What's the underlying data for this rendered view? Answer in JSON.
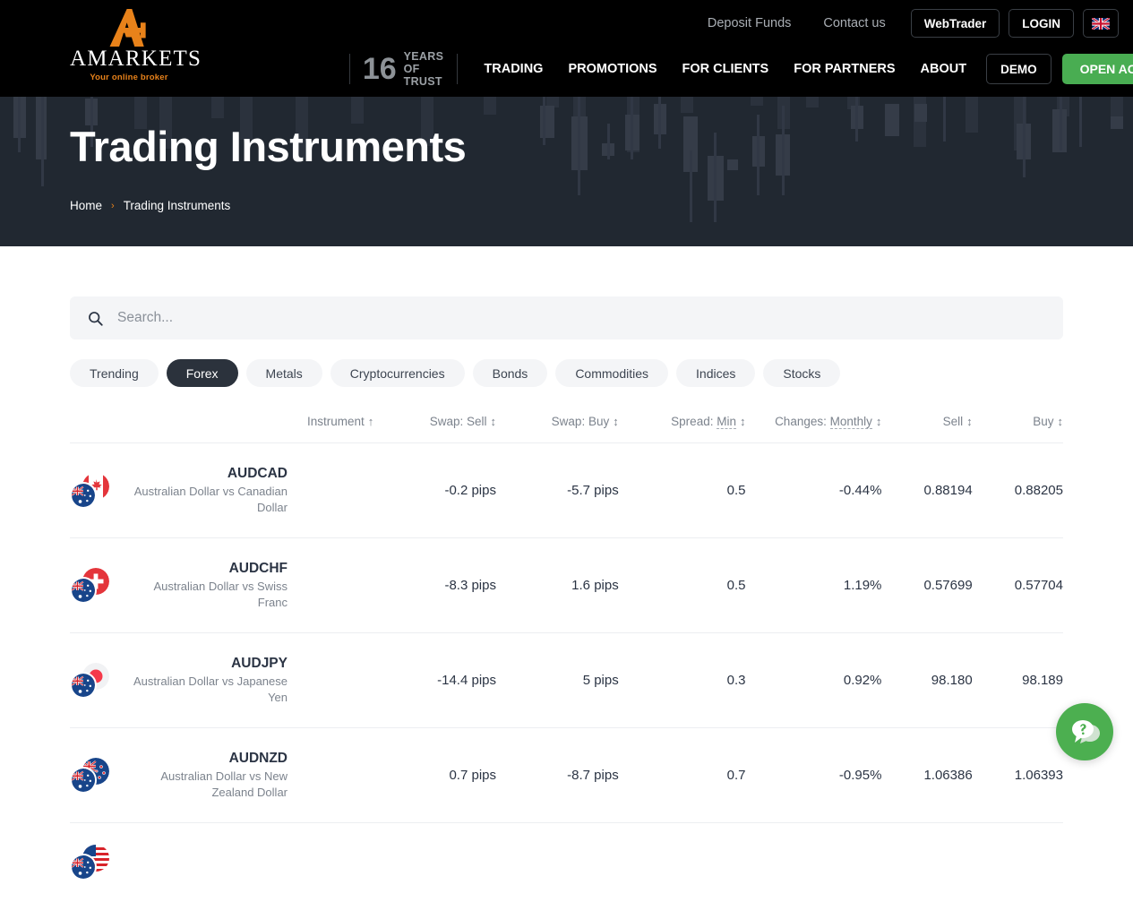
{
  "header": {
    "logo": {
      "word": "AMARKETS",
      "tagline": "Your online broker"
    },
    "top_links": [
      {
        "label": "Deposit Funds"
      },
      {
        "label": "Contact us"
      }
    ],
    "top_buttons": [
      {
        "label": "WebTrader"
      },
      {
        "label": "LOGIN"
      }
    ],
    "language_flag": "uk-flag-icon",
    "trust_badge": {
      "number": "16",
      "line1": "YEARS",
      "line2": "OF TRUST"
    },
    "nav_links": [
      {
        "label": "TRADING"
      },
      {
        "label": "PROMOTIONS"
      },
      {
        "label": "FOR CLIENTS"
      },
      {
        "label": "FOR PARTNERS"
      },
      {
        "label": "ABOUT"
      }
    ],
    "demo_label": "DEMO",
    "open_account_label": "OPEN ACCOUNT",
    "accent_green": "#49ad52",
    "accent_orange": "#e8821a"
  },
  "hero": {
    "title": "Trading Instruments",
    "breadcrumb": {
      "home": "Home",
      "separator": "›",
      "current": "Trading Instruments"
    },
    "background": "#212831"
  },
  "search": {
    "placeholder": "Search...",
    "value": "",
    "icon": "search-icon"
  },
  "filters": {
    "items": [
      {
        "label": "Trending",
        "active": false
      },
      {
        "label": "Forex",
        "active": true
      },
      {
        "label": "Metals",
        "active": false
      },
      {
        "label": "Cryptocurrencies",
        "active": false
      },
      {
        "label": "Bonds",
        "active": false
      },
      {
        "label": "Commodities",
        "active": false
      },
      {
        "label": "Indices",
        "active": false
      },
      {
        "label": "Stocks",
        "active": false
      }
    ]
  },
  "table": {
    "columns": [
      {
        "label": "Instrument",
        "sort": "↑",
        "selector": null
      },
      {
        "label": "Swap: Sell",
        "sort": "↕",
        "selector": null
      },
      {
        "label": "Swap: Buy",
        "sort": "↕",
        "selector": null
      },
      {
        "label": "Spread:",
        "sort": "↕",
        "selector": "Min"
      },
      {
        "label": "Changes:",
        "sort": "↕",
        "selector": "Monthly"
      },
      {
        "label": "Sell",
        "sort": "↕",
        "selector": null
      },
      {
        "label": "Buy",
        "sort": "↕",
        "selector": null
      }
    ],
    "rows": [
      {
        "symbol": "AUDCAD",
        "description": "Australian Dollar vs Canadian Dollar",
        "swap_sell": "-0.2 pips",
        "swap_buy": "-5.7 pips",
        "spread": "0.5",
        "change": "-0.44%",
        "change_dir": "neg",
        "sell": "0.88194",
        "buy": "0.88205",
        "flag_front": "au",
        "flag_back": "ca"
      },
      {
        "symbol": "AUDCHF",
        "description": "Australian Dollar vs Swiss Franc",
        "swap_sell": "-8.3 pips",
        "swap_buy": "1.6 pips",
        "spread": "0.5",
        "change": "1.19%",
        "change_dir": "pos",
        "sell": "0.57699",
        "buy": "0.57704",
        "flag_front": "au",
        "flag_back": "ch"
      },
      {
        "symbol": "AUDJPY",
        "description": "Australian Dollar vs Japanese Yen",
        "swap_sell": "-14.4 pips",
        "swap_buy": "5 pips",
        "spread": "0.3",
        "change": "0.92%",
        "change_dir": "pos",
        "sell": "98.180",
        "buy": "98.189",
        "flag_front": "au",
        "flag_back": "jp"
      },
      {
        "symbol": "AUDNZD",
        "description": "Australian Dollar vs New Zealand Dollar",
        "swap_sell": "0.7 pips",
        "swap_buy": "-8.7 pips",
        "spread": "0.7",
        "change": "-0.95%",
        "change_dir": "neg",
        "sell": "1.06386",
        "buy": "1.06393",
        "flag_front": "au",
        "flag_back": "nz"
      },
      {
        "symbol": "",
        "description": "",
        "swap_sell": "",
        "swap_buy": "",
        "spread": "",
        "change": "",
        "change_dir": "",
        "sell": "",
        "buy": "",
        "flag_front": "au",
        "flag_back": "us"
      }
    ],
    "colors": {
      "positive": "#5cb85c",
      "negative": "#ef5350"
    }
  },
  "chat": {
    "icon": "help-chat-icon",
    "color": "#4caf50"
  }
}
